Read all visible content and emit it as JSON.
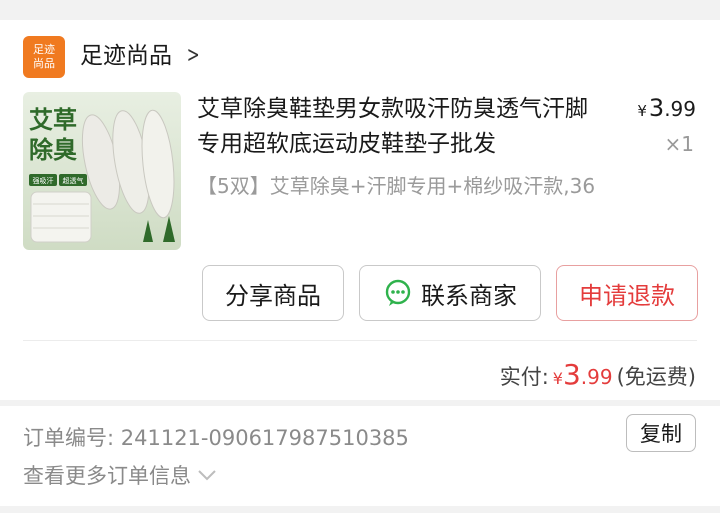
{
  "store": {
    "logo_text": "足迹尚品",
    "name": "足迹尚品"
  },
  "product": {
    "image_text_top": "艾草",
    "image_text_bottom": "除臭",
    "image_tag_1": "强吸汗",
    "image_tag_2": "超透气",
    "title": "艾草除臭鞋垫男女款吸汗防臭透气汗脚专用超软底运动皮鞋垫子批发",
    "sku": "【5双】艾草除臭+汗脚专用+棉纱吸汗款,36",
    "price_symbol": "¥",
    "price_int": "3",
    "price_dec": ".99",
    "quantity": "×1"
  },
  "actions": {
    "share": "分享商品",
    "contact": "联系商家",
    "refund": "申请退款"
  },
  "payment": {
    "label": "实付:",
    "symbol": "¥",
    "int": "3",
    "dec": ".99",
    "note": "(免运费)"
  },
  "order": {
    "number_label": "订单编号:  241121-090617987510385",
    "copy_label": "复制",
    "more_label": "查看更多订单信息"
  },
  "colors": {
    "accent_red": "#e43c3c",
    "store_orange": "#f07a20",
    "wechat_green": "#2fb24c"
  }
}
